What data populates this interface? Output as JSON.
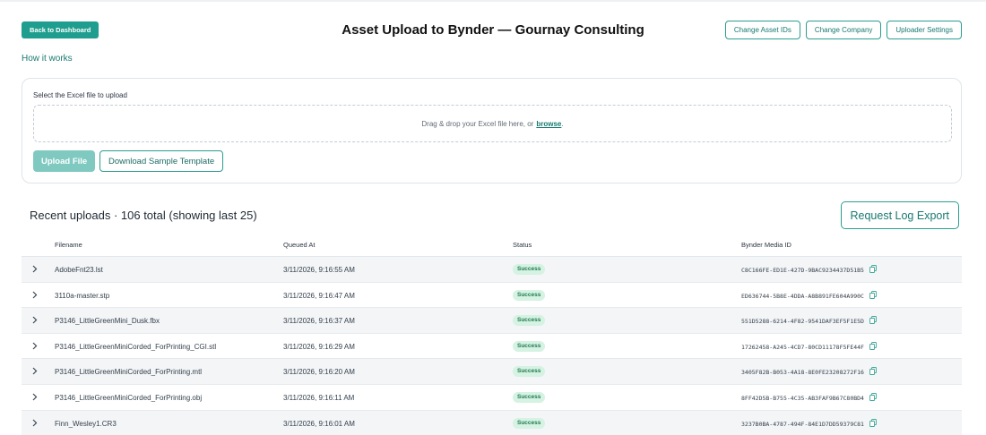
{
  "header": {
    "back_label": "Back to Dashboard",
    "title": "Asset Upload to Bynder — Gournay Consulting",
    "actions": [
      "Change Asset IDs",
      "Change Company",
      "Uploader Settings"
    ],
    "how_link": "How it works"
  },
  "upload": {
    "label": "Select the Excel file to upload",
    "drop_text": "Drag & drop your Excel file here, or",
    "browse": "browse",
    "drop_suffix": ".",
    "upload_button": "Upload File",
    "template_button": "Download Sample Template"
  },
  "recent": {
    "title": "Recent uploads · 106 total (showing last 25)",
    "export_button": "Request Log Export",
    "columns": [
      "Filename",
      "Queued At",
      "Status",
      "Bynder Media ID"
    ],
    "rows": [
      {
        "filename": "AdobeFnt23.lst",
        "queued": "3/11/2026, 9:16:55 AM",
        "status": "Success",
        "media_id": "C8C166FE-ED1E-427D-9BAC9234437D51B5"
      },
      {
        "filename": "3110a-master.stp",
        "queued": "3/11/2026, 9:16:47 AM",
        "status": "Success",
        "media_id": "ED636744-5B8E-4DDA-A8B891FE604A990C"
      },
      {
        "filename": "P3146_LittleGreenMini_Dusk.fbx",
        "queued": "3/11/2026, 9:16:37 AM",
        "status": "Success",
        "media_id": "551D5288-6214-4F82-9541DAF3EF5F1E5D"
      },
      {
        "filename": "P3146_LittleGreenMiniCorded_ForPrinting_CGI.stl",
        "queued": "3/11/2026, 9:16:29 AM",
        "status": "Success",
        "media_id": "17262458-A245-4CD7-80CD11178F5FE44F"
      },
      {
        "filename": "P3146_LittleGreenMiniCorded_ForPrinting.mtl",
        "queued": "3/11/2026, 9:16:20 AM",
        "status": "Success",
        "media_id": "3405F82B-B053-4A18-8E0FE23208272F16"
      },
      {
        "filename": "P3146_LittleGreenMiniCorded_ForPrinting.obj",
        "queued": "3/11/2026, 9:16:11 AM",
        "status": "Success",
        "media_id": "8FF42D5B-B755-4C35-AB3FAF9B67C80BD4"
      },
      {
        "filename": "Finn_Wesley1.CR3",
        "queued": "3/11/2026, 9:16:01 AM",
        "status": "Success",
        "media_id": "3237B0BA-4787-494F-84E1D7DD59379C81"
      }
    ]
  },
  "colors": {
    "accent": "#1f9e8f",
    "accent_text": "#177a70",
    "success_bg": "#d5f2e3",
    "success_text": "#1f7a4d"
  },
  "icons": {
    "expand": "chevron-right-icon",
    "copy": "copy-icon"
  }
}
